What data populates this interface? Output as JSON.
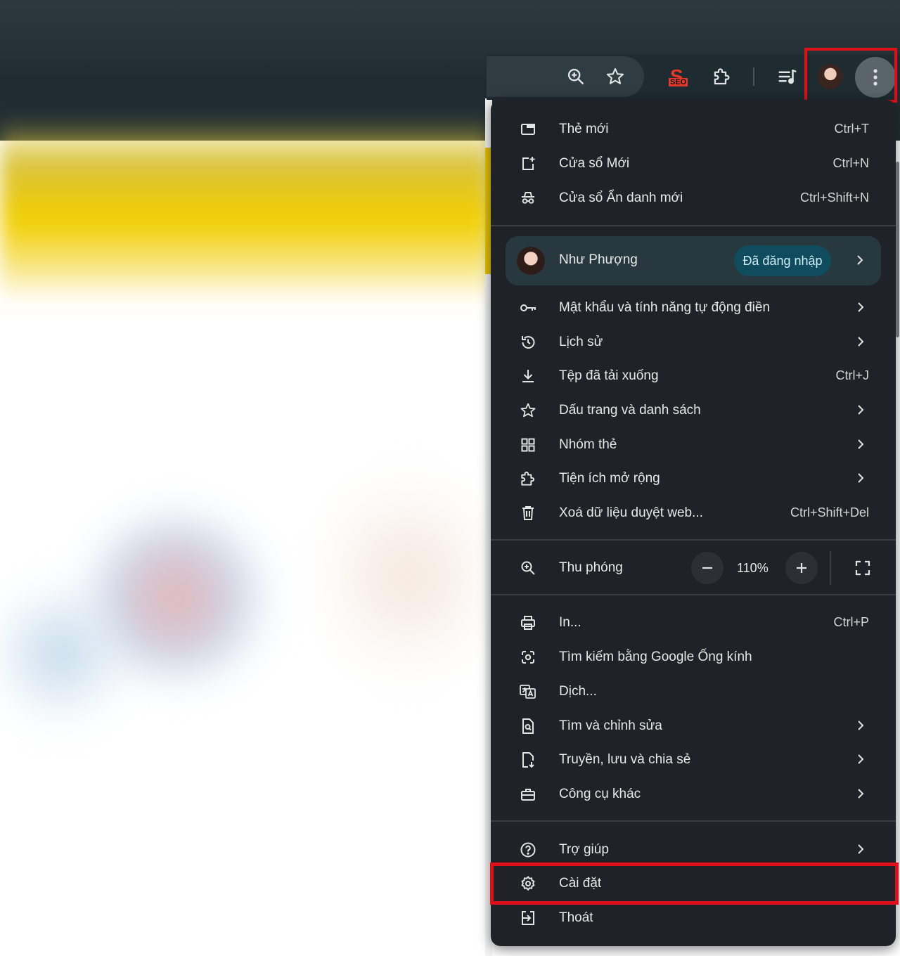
{
  "toolbar": {
    "icons": [
      "zoom-icon",
      "bookmark-star-icon",
      "seo-extension-icon",
      "extensions-puzzle-icon",
      "reading-list-icon",
      "profile-avatar",
      "menu-kebab-icon"
    ],
    "seo_badge_text": "SEO"
  },
  "menu": {
    "new_tab": {
      "label": "Thẻ mới",
      "shortcut": "Ctrl+T"
    },
    "new_window": {
      "label": "Cửa sổ Mới",
      "shortcut": "Ctrl+N"
    },
    "incognito": {
      "label": "Cửa sổ Ẩn danh mới",
      "shortcut": "Ctrl+Shift+N"
    },
    "profile": {
      "name": "Như Phượng",
      "status": "Đã đăng nhập"
    },
    "passwords": {
      "label": "Mật khẩu và tính năng tự động điền"
    },
    "history": {
      "label": "Lịch sử"
    },
    "downloads": {
      "label": "Tệp đã tải xuống",
      "shortcut": "Ctrl+J"
    },
    "bookmarks": {
      "label": "Dấu trang và danh sách"
    },
    "tab_groups": {
      "label": "Nhóm thẻ"
    },
    "extensions": {
      "label": "Tiện ích mở rộng"
    },
    "clear_data": {
      "label": "Xoá dữ liệu duyệt web...",
      "shortcut": "Ctrl+Shift+Del"
    },
    "zoom": {
      "label": "Thu phóng",
      "value": "110%"
    },
    "print": {
      "label": "In...",
      "shortcut": "Ctrl+P"
    },
    "lens": {
      "label": "Tìm kiếm bằng Google Ống kính"
    },
    "translate": {
      "label": "Dịch..."
    },
    "find_edit": {
      "label": "Tìm và chỉnh sửa"
    },
    "cast_save_share": {
      "label": "Truyền, lưu và chia sẻ"
    },
    "more_tools": {
      "label": "Công cụ khác"
    },
    "help": {
      "label": "Trợ giúp"
    },
    "settings": {
      "label": "Cài đặt"
    },
    "exit": {
      "label": "Thoát"
    }
  },
  "colors": {
    "menu_bg": "#1f2226",
    "profile_bg": "#27393f",
    "badge_bg": "#0f4c5d",
    "highlight": "#e0101a"
  }
}
